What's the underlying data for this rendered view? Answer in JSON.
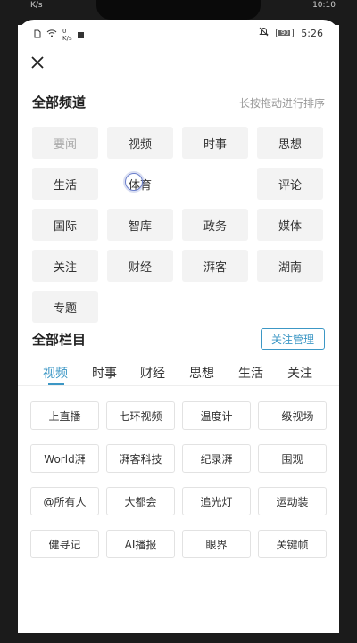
{
  "outer_status": {
    "left": "K/s",
    "time": "10:10"
  },
  "status_bar": {
    "net_speed_value": "0",
    "net_speed_unit": "K/s",
    "battery_level": "90",
    "time": "5:26"
  },
  "all_channels": {
    "title": "全部频道",
    "hint": "长按拖动进行排序",
    "items": [
      "要闻",
      "视频",
      "时事",
      "思想",
      "生活",
      "体育",
      "",
      "评论",
      "国际",
      "智库",
      "政务",
      "媒体",
      "关注",
      "财经",
      "湃客",
      "湖南",
      "专题"
    ]
  },
  "all_columns": {
    "title": "全部栏目",
    "follow_manage_label": "关注管理",
    "tabs": [
      "视频",
      "时事",
      "财经",
      "思想",
      "生活",
      "关注"
    ],
    "active_tab": "视频",
    "items": [
      "上直播",
      "七环视频",
      "温度计",
      "一级视场",
      "World湃",
      "湃客科技",
      "纪录湃",
      "围观",
      "@所有人",
      "大都会",
      "追光灯",
      "运动装",
      "健寻记",
      "AI播报",
      "眼界",
      "关键帧"
    ]
  },
  "colors": {
    "accent": "#3c97c5",
    "chip_bg": "#f3f3f3",
    "fixed_text": "#aaaaaa"
  }
}
